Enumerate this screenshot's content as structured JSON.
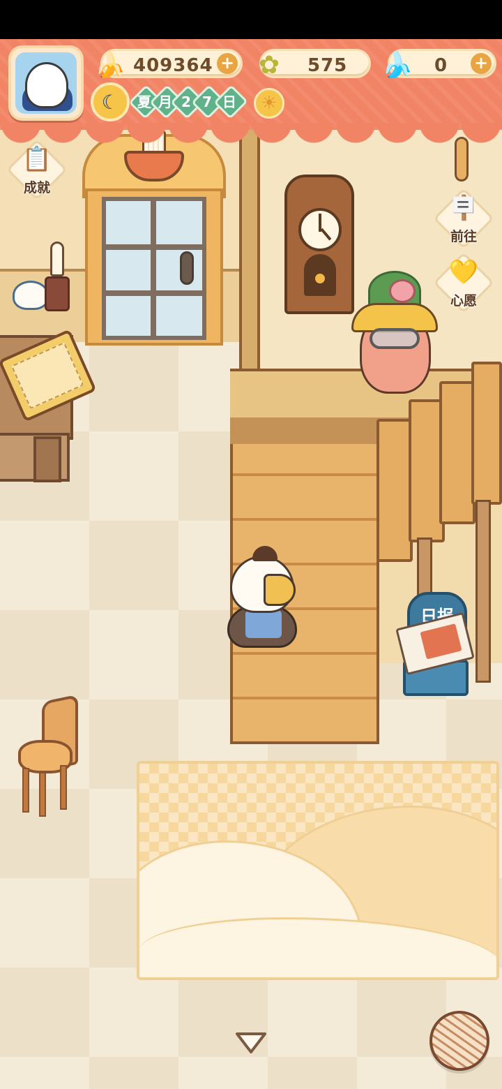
{
  "hud": {
    "bananas": "409364",
    "clovers": "575",
    "blue_bananas": "0",
    "plus": "+",
    "date": {
      "season": "夏",
      "month_label": "月",
      "day_digit1": "2",
      "day_digit2": "7",
      "day_label": "日"
    },
    "weather_icon": "sun-icon"
  },
  "side_buttons": {
    "achievements": "成就",
    "goto": "前往",
    "wishes": "心愿"
  },
  "scene": {
    "newspaper_sign": "日报"
  },
  "icons": {
    "banana": "🍌",
    "clover": "✿",
    "blue_banana": "🍌",
    "moon": "☾",
    "sun": "☀",
    "achievements": "📋",
    "goto": "🪧",
    "wishes": "💛"
  },
  "colors": {
    "header": "#f28466",
    "accent": "#e9a543",
    "date_tag": "#5fb28a"
  }
}
